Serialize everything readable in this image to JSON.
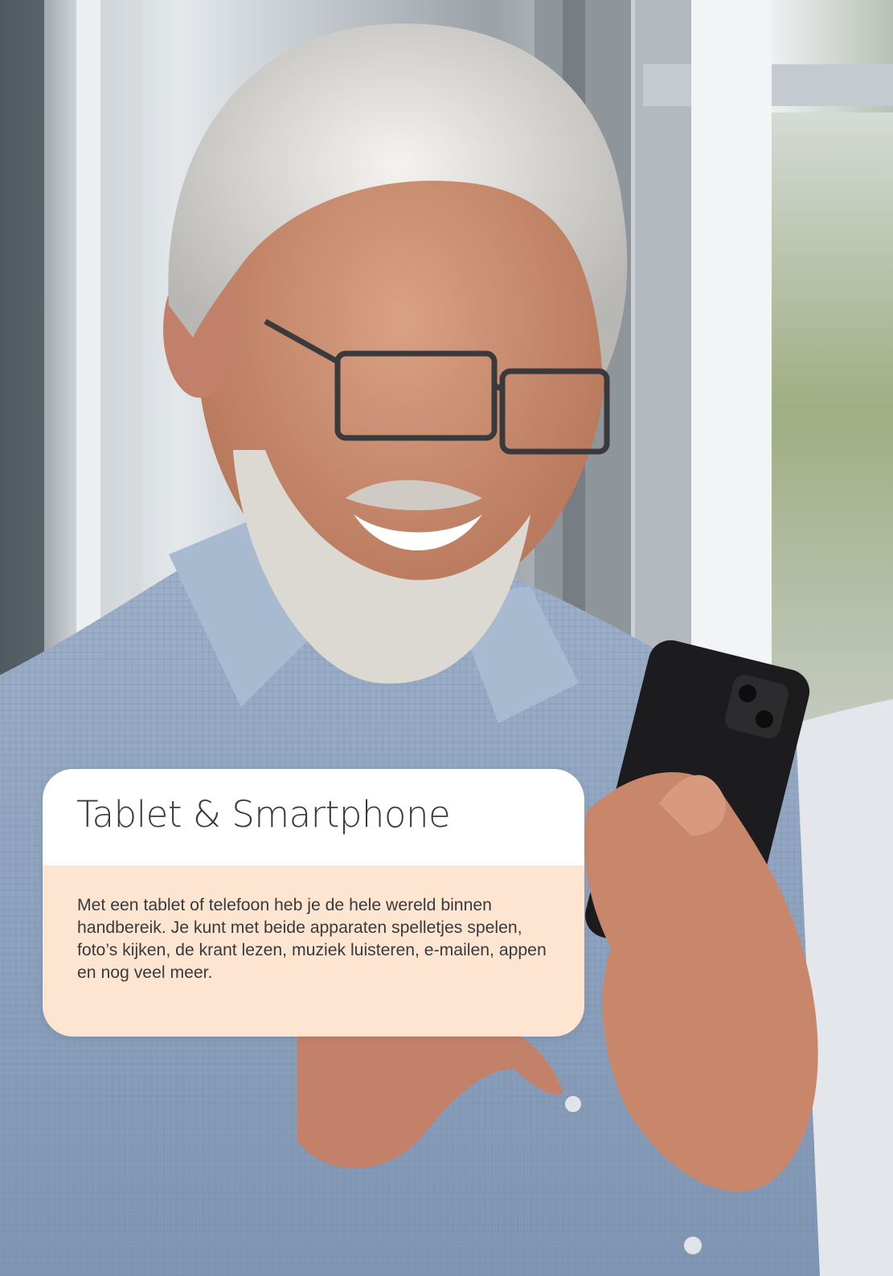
{
  "photo": {
    "subject": "man-with-phone-photo",
    "colors": {
      "window_light": "#e8ecef",
      "window_frame": "#a3a9ae",
      "shirt": "#8ea3bf",
      "skin": "#c98c6f",
      "hair": "#e9e7e3",
      "phone": "#1c1c1e",
      "greenery": "#8f9f74"
    }
  },
  "card": {
    "title": "Tablet & Smartphone",
    "body": "Met een tablet of telefoon heb je de hele wereld binnen handbereik. Je kunt met beide apparaten spelletjes spelen, foto’s kijken, de krant lezen, muziek luisteren, e-mailen, appen en nog veel meer.",
    "head_color": "#ffffff",
    "body_color": "#fde5d2"
  }
}
